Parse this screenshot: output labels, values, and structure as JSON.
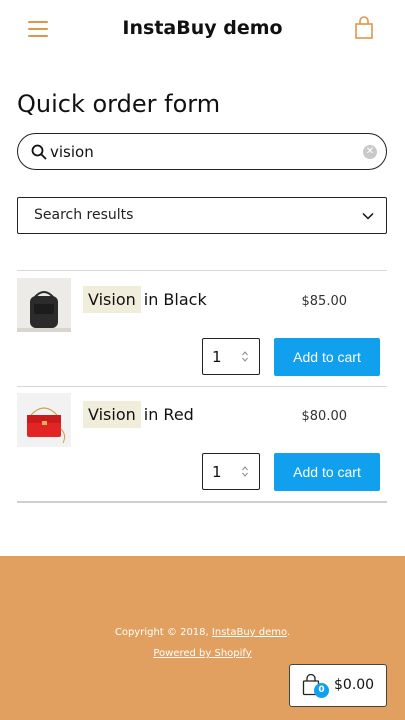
{
  "header": {
    "logo": "InstaBuy demo",
    "menu_icon": "hamburger-menu-icon",
    "bag_icon": "shopping-bag-icon"
  },
  "page": {
    "title": "Quick order form"
  },
  "search": {
    "value": "vision",
    "placeholder": ""
  },
  "results_select": {
    "selected": "Search results"
  },
  "results": [
    {
      "highlight": "Vision",
      "rest": "in Black",
      "price": "$85.00",
      "qty": "1",
      "button": "Add to cart"
    },
    {
      "highlight": "Vision",
      "rest": "in Red",
      "price": "$80.00",
      "qty": "1",
      "button": "Add to cart"
    }
  ],
  "footer": {
    "copyright_prefix": "Copyright © 2018,",
    "store_link": "InstaBuy demo",
    "copyright_suffix": ".",
    "powered": "Powered by Shopify"
  },
  "cart": {
    "count": "0",
    "total": "$0.00"
  },
  "colors": {
    "accent": "#e1954a",
    "footer_bg": "#e1a05f",
    "button": "#11a0ed",
    "highlight": "#f1eddb"
  }
}
